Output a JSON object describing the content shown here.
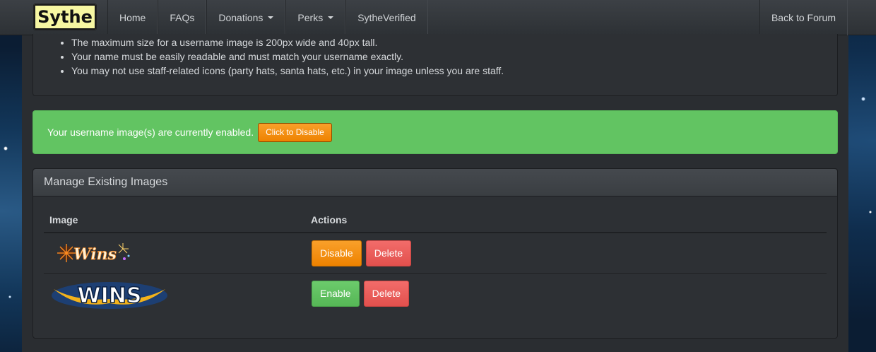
{
  "navbar": {
    "logo": "Sythe",
    "items": [
      {
        "label": "Home",
        "has_caret": false
      },
      {
        "label": "FAQs",
        "has_caret": false
      },
      {
        "label": "Donations",
        "has_caret": true
      },
      {
        "label": "Perks",
        "has_caret": true
      },
      {
        "label": "SytheVerified",
        "has_caret": false
      }
    ],
    "back_label": "Back to Forum"
  },
  "rules": [
    "The maximum size for a username image is 200px wide and 40px tall.",
    "Your name must be easily readable and must match your username exactly.",
    "You may not use staff-related icons (party hats, santa hats, etc.) in your image unless you are staff."
  ],
  "alert": {
    "text": "Your username image(s) are currently enabled.",
    "button_label": "Click to Disable"
  },
  "manage": {
    "title": "Manage Existing Images",
    "col_image": "Image",
    "col_actions": "Actions",
    "rows": [
      {
        "image_text": "Wins",
        "primary_label": "Disable",
        "delete_label": "Delete"
      },
      {
        "image_text": "WINS",
        "primary_label": "Enable",
        "delete_label": "Delete"
      }
    ]
  },
  "colors": {
    "alert_green": "#62c462",
    "orange": "#f89406",
    "red": "#ee5f5b",
    "green": "#62c462",
    "logo_bg": "#f7f7a2"
  }
}
